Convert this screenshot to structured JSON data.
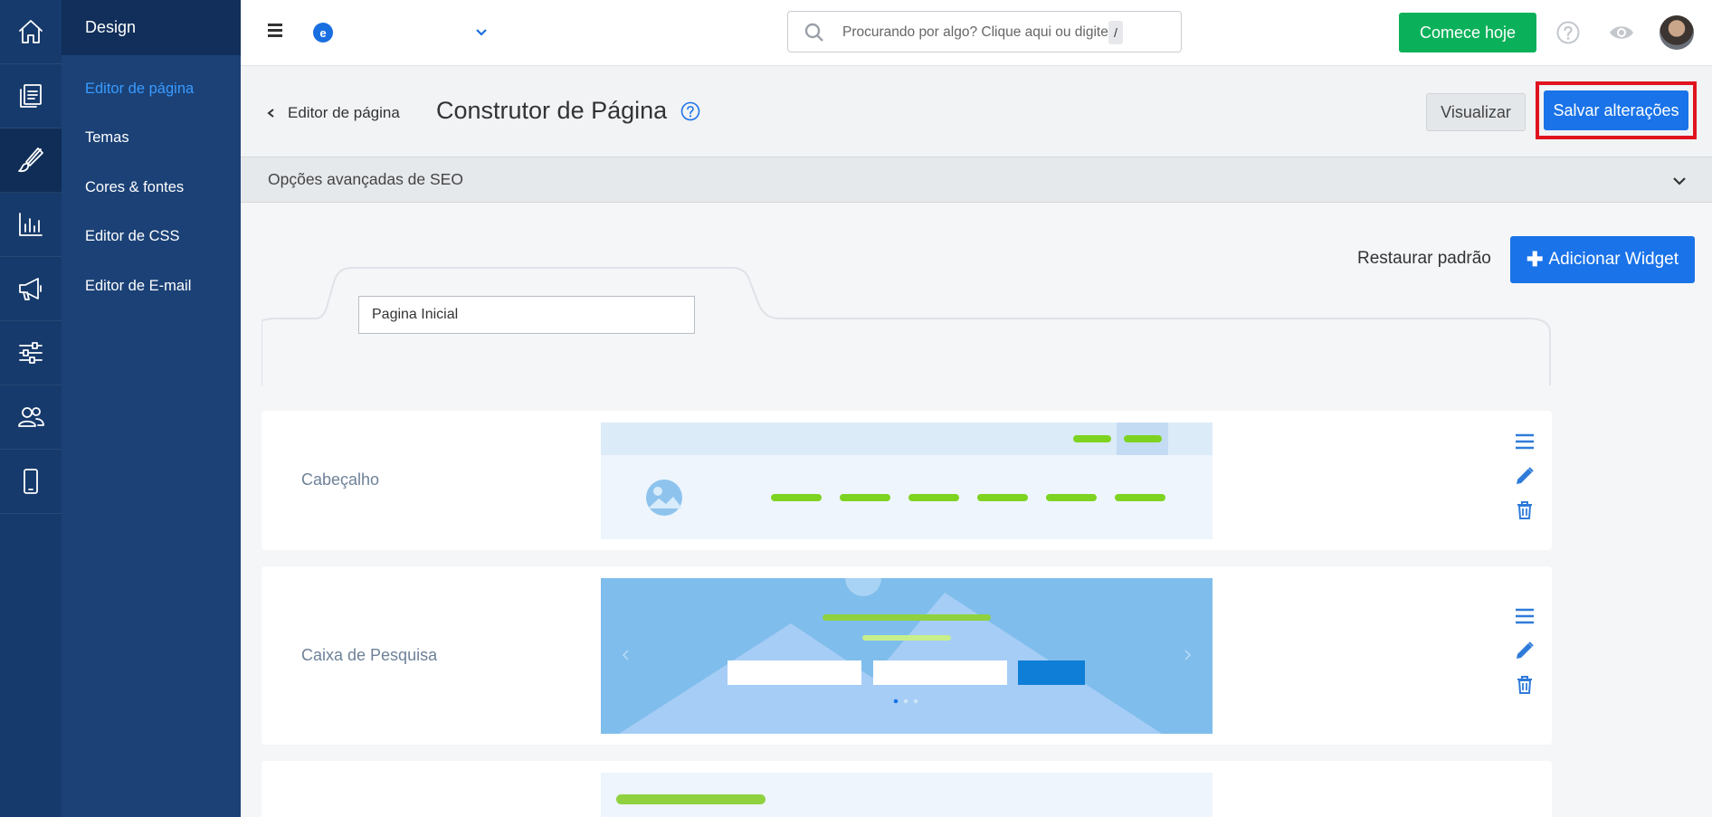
{
  "rail": {
    "items": [
      {
        "icon": "home-icon"
      },
      {
        "icon": "pages-icon"
      },
      {
        "icon": "brush-icon",
        "active": true
      },
      {
        "icon": "chart-icon"
      },
      {
        "icon": "megaphone-icon"
      },
      {
        "icon": "sliders-icon"
      },
      {
        "icon": "users-icon"
      },
      {
        "icon": "mobile-icon"
      }
    ]
  },
  "sidebar": {
    "title": "Design",
    "items": [
      {
        "label": "Editor de página",
        "active": true
      },
      {
        "label": "Temas"
      },
      {
        "label": "Cores & fontes"
      },
      {
        "label": "Editor de CSS"
      },
      {
        "label": "Editor de E-mail"
      }
    ]
  },
  "topbar": {
    "logo_letter": "e",
    "search_placeholder": "Procurando por algo? Clique aqui ou digite",
    "search_shortcut": "/",
    "cta_label": "Comece hoje"
  },
  "header": {
    "back_label": "Editor de página",
    "title": "Construtor de Página",
    "preview_label": "Visualizar",
    "save_label": "Salvar alterações"
  },
  "seo": {
    "label": "Opções avançadas de SEO"
  },
  "actions": {
    "restore_label": "Restaurar padrão",
    "add_widget_label": "Adicionar Widget"
  },
  "tab": {
    "page_name": "Pagina Inicial"
  },
  "widgets": [
    {
      "label": "Cabeçalho"
    },
    {
      "label": "Caixa de Pesquisa"
    }
  ],
  "colors": {
    "rail_bg": "#163a6b",
    "sidebar_bg": "#1b4176",
    "accent_blue": "#1a73e8",
    "cta_green": "#0bb15a",
    "highlight_red": "#e0141e",
    "preview_green": "#7ed321"
  }
}
